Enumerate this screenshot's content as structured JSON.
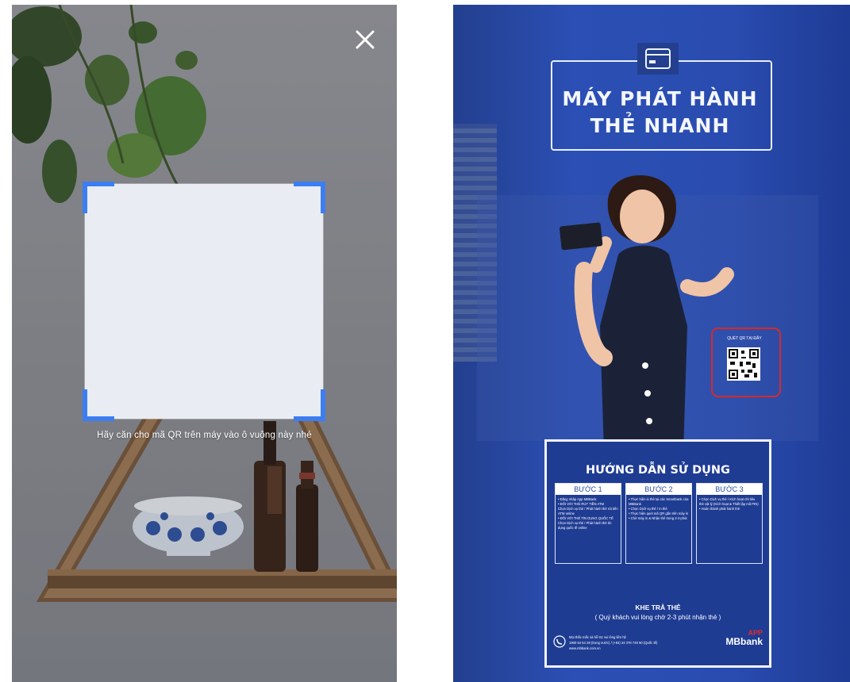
{
  "scanner": {
    "instruction": "Hãy căn cho mã QR trên máy vào ô vuông này nhé",
    "close_icon": "close-icon",
    "frame_accent": "#3d7df2"
  },
  "kiosk": {
    "title_line1": "MÁY PHÁT HÀNH",
    "title_line2": "THẺ NHANH",
    "qr_label": "QUÉT QR TẠI ĐÂY",
    "qr_highlight_color": "#d62a2a",
    "guide": {
      "title": "HƯỚNG DẪN SỬ DỤNG",
      "steps": [
        {
          "label": "BƯỚC 1",
          "lines": [
            "• Đăng nhập App MBBank",
            "• ĐỐI VỚI THẺ RÚT TIỀN ATM",
            "Chọn Dịch vụ thẻ / Phát hành thẻ rút tiền ATM online",
            "• ĐỐI VỚI THẺ TÍN DỤNG QUỐC TẾ",
            "Chọn Dịch vụ thẻ / Phát hành thẻ tín dụng quốc tế online"
          ]
        },
        {
          "label": "BƯỚC 2",
          "lines": [
            "• Thực hiện in thẻ tại các Smartbank của MBBank",
            "• Chọn Dịch vụ thẻ / In thẻ",
            "• Thực hiện quét mã QR gắn trên máy in",
            "• Chờ máy in & Nhận thẻ trong 2-3 phút"
          ]
        },
        {
          "label": "BƯỚC 3",
          "lines": [
            "• Chọn Dịch vụ thẻ / Kích hoạt chỉ tiêu thẻ vật lý (Kích hoạt & Thiết lập mã PIN)",
            "• Hoàn thành phát hành thẻ"
          ]
        }
      ],
      "return_label": "KHE TRẢ THẺ",
      "return_sub": "( Quý khách vui lòng chờ 2-3 phút nhận thẻ )",
      "hotline_line1": "Mọi thắc mắc và hỗ trợ vui lòng liên hệ",
      "hotline_line2": "1900 54 54 26 (trong nước) / (+84) 24 376 740 50 (Quốc tế)",
      "hotline_line3": "www.mbbank.com.vn",
      "brand_app": "APP",
      "brand_name": "MBbank"
    }
  }
}
